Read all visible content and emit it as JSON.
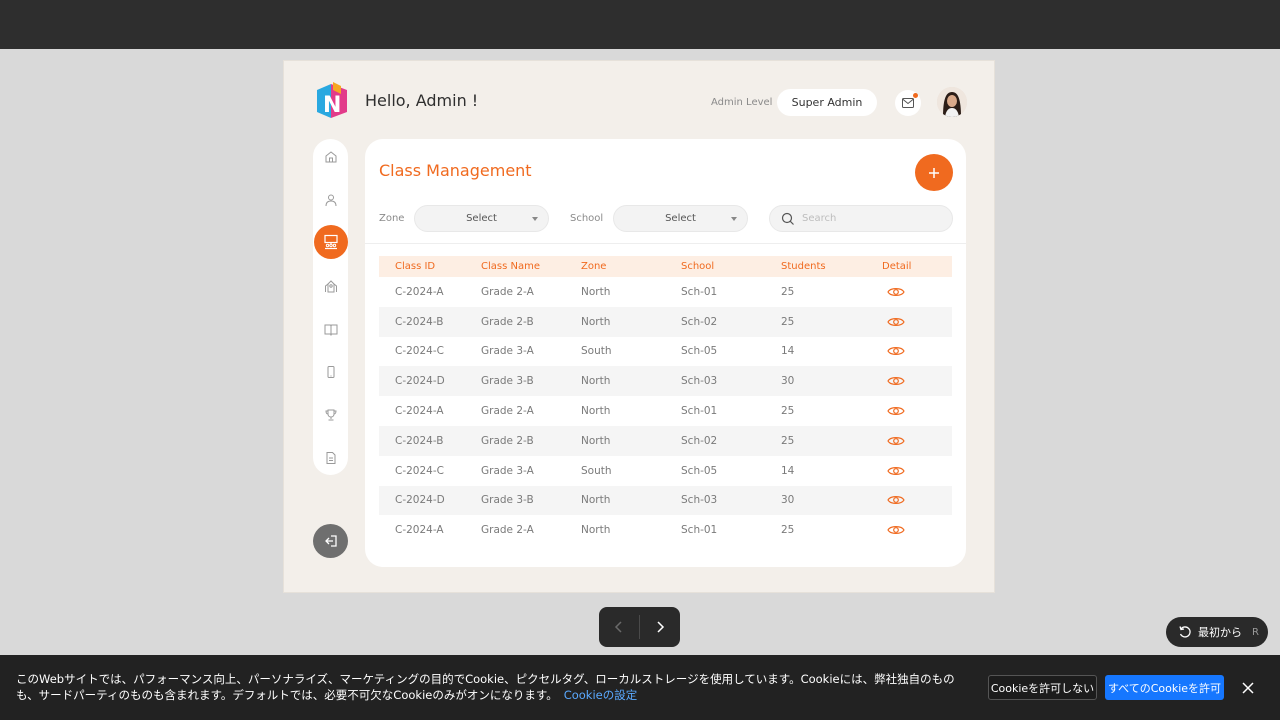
{
  "header": {
    "greeting": "Hello, Admin !",
    "admin_level_label": "Admin Level",
    "admin_level_value": "Super Admin"
  },
  "card": {
    "title": "Class Management",
    "filters": {
      "zone_label": "Zone",
      "zone_value": "Select",
      "school_label": "School",
      "school_value": "Select",
      "search_placeholder": "Search"
    },
    "columns": [
      "Class ID",
      "Class Name",
      "Zone",
      "School",
      "Students",
      "Detail"
    ],
    "rows": [
      [
        "C-2024-A",
        "Grade 2-A",
        "North",
        "Sch-01",
        "25"
      ],
      [
        "C-2024-B",
        "Grade 2-B",
        "North",
        "Sch-02",
        "25"
      ],
      [
        "C-2024-C",
        "Grade 3-A",
        "South",
        "Sch-05",
        "14"
      ],
      [
        "C-2024-D",
        "Grade 3-B",
        "North",
        "Sch-03",
        "30"
      ],
      [
        "C-2024-A",
        "Grade 2-A",
        "North",
        "Sch-01",
        "25"
      ],
      [
        "C-2024-B",
        "Grade 2-B",
        "North",
        "Sch-02",
        "25"
      ],
      [
        "C-2024-C",
        "Grade 3-A",
        "South",
        "Sch-05",
        "14"
      ],
      [
        "C-2024-D",
        "Grade 3-B",
        "North",
        "Sch-03",
        "30"
      ],
      [
        "C-2024-A",
        "Grade 2-A",
        "North",
        "Sch-01",
        "25"
      ]
    ]
  },
  "sidebar": {
    "items": [
      {
        "icon": "home-icon"
      },
      {
        "icon": "user-icon"
      },
      {
        "icon": "class-icon",
        "active": true
      },
      {
        "icon": "school-icon"
      },
      {
        "icon": "book-icon"
      },
      {
        "icon": "phone-icon"
      },
      {
        "icon": "trophy-icon"
      },
      {
        "icon": "document-icon"
      }
    ],
    "logout_icon": "logout-icon"
  },
  "player": {
    "restart_label": "最初から",
    "restart_key": "R"
  },
  "cookie_banner": {
    "text": "このWebサイトでは、パフォーマンス向上、パーソナライズ、マーケティングの目的でCookie、ピクセルタグ、ローカルストレージを使用しています。Cookieには、弊社独自のものも、サードパーティのものも含まれます。デフォルトでは、必要不可欠なCookieのみがオンになります。",
    "settings_link": "Cookieの設定",
    "decline_label": "Cookieを許可しない",
    "accept_label": "すべてのCookieを許可"
  },
  "colors": {
    "accent": "#f06a1f",
    "accept_blue": "#1677ff"
  }
}
